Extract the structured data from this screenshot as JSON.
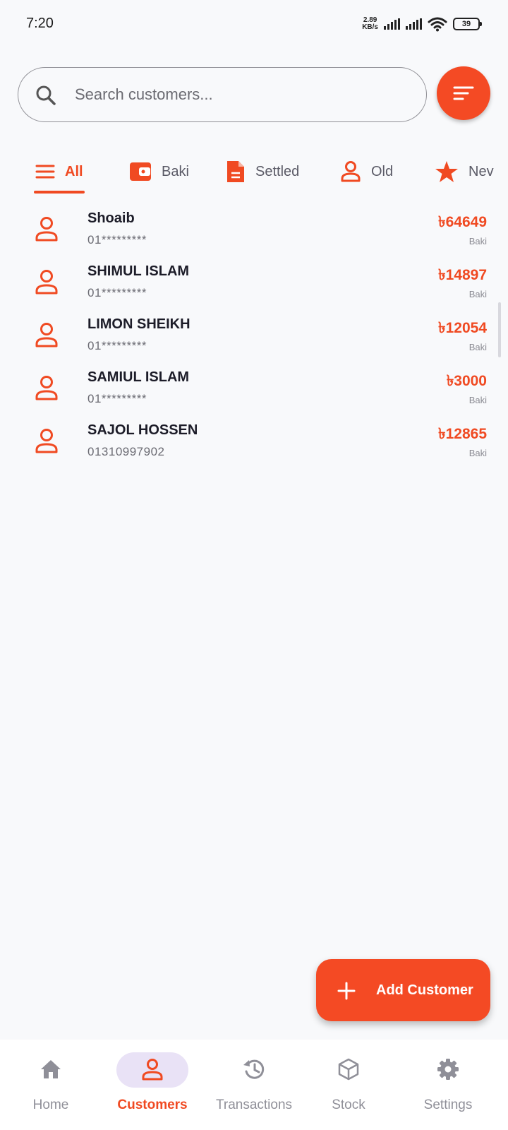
{
  "status_bar": {
    "time": "7:20",
    "net_speed_value": "2.89",
    "net_speed_unit": "KB/s",
    "battery": "39"
  },
  "search": {
    "placeholder": "Search customers...",
    "value": ""
  },
  "filter_button": {
    "icon": "sort-lines-icon"
  },
  "tabs": [
    {
      "label": "All",
      "icon": "menu-lines-icon",
      "active": true
    },
    {
      "label": "Baki",
      "icon": "wallet-icon",
      "active": false
    },
    {
      "label": "Settled",
      "icon": "document-icon",
      "active": false
    },
    {
      "label": "Old",
      "icon": "person-icon",
      "active": false
    },
    {
      "label": "Nev",
      "icon": "star-icon",
      "active": false
    }
  ],
  "customers": [
    {
      "name": "Shoaib",
      "phone": "01*********",
      "amount": "৳64649",
      "status": "Baki"
    },
    {
      "name": "SHIMUL ISLAM",
      "phone": "01*********",
      "amount": "৳14897",
      "status": "Baki"
    },
    {
      "name": "LIMON SHEIKH",
      "phone": "01*********",
      "amount": "৳12054",
      "status": "Baki"
    },
    {
      "name": "SAMIUL ISLAM",
      "phone": "01*********",
      "amount": "৳3000",
      "status": "Baki"
    },
    {
      "name": "SAJOL HOSSEN",
      "phone": "01310997902",
      "amount": "৳12865",
      "status": "Baki"
    }
  ],
  "fab": {
    "label": "Add Customer",
    "icon": "plus-icon"
  },
  "bottom_nav": [
    {
      "label": "Home",
      "icon": "home-icon",
      "active": false
    },
    {
      "label": "Customers",
      "icon": "person-icon",
      "active": true
    },
    {
      "label": "Transactions",
      "icon": "history-icon",
      "active": false
    },
    {
      "label": "Stock",
      "icon": "box-icon",
      "active": false
    },
    {
      "label": "Settings",
      "icon": "gear-icon",
      "active": false
    }
  ],
  "colors": {
    "accent": "#f04a22",
    "background": "#f8f9fb",
    "active_nav_pill": "#e9e2f6",
    "text_primary": "#1c1c28",
    "text_muted": "#8f8f98"
  }
}
